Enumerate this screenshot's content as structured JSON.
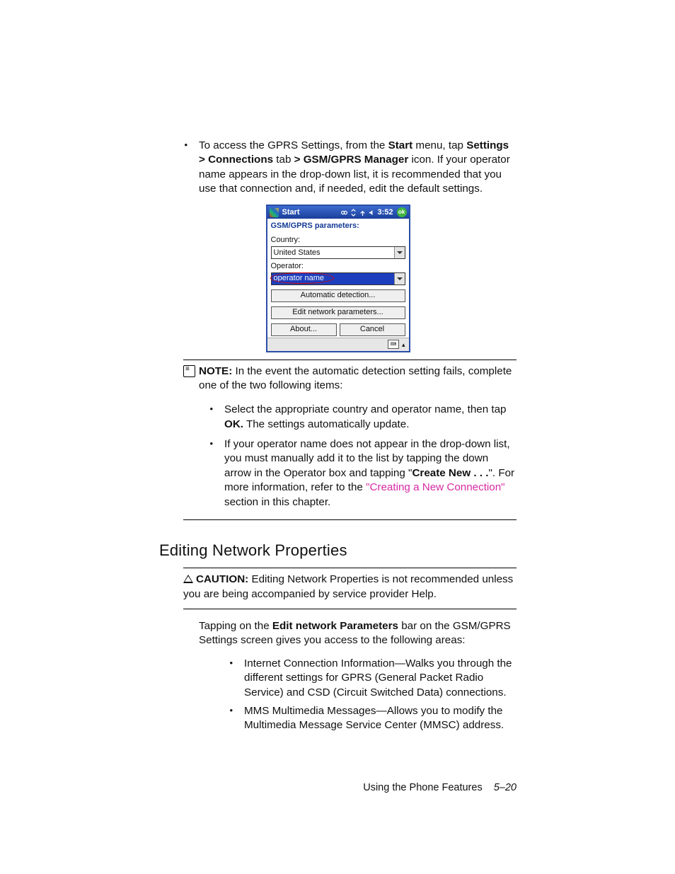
{
  "intro": {
    "prefix": "To access the GPRS Settings, from the ",
    "start": "Start",
    "mid1": " menu, tap ",
    "settings_path": "Settings > Connections",
    "mid2": " tab ",
    "gsm_path": "> GSM/GPRS Manager",
    "tail": " icon. If your operator name appears in the drop-down list, it is recommended that you use that connection and, if needed, edit the default settings."
  },
  "screenshot": {
    "start": "Start",
    "time": "3:52",
    "ok": "ok",
    "heading": "GSM/GPRS parameters:",
    "country_label": "Country:",
    "country_value": "United States",
    "operator_label": "Operator:",
    "operator_value": "operator name",
    "btn_auto": "Automatic detection...",
    "btn_edit": "Edit network parameters...",
    "btn_about": "About...",
    "btn_cancel": "Cancel"
  },
  "note": {
    "label": "NOTE:",
    "text": "In the event the automatic detection setting fails, complete one of the two following items:"
  },
  "note_bullets": [
    {
      "pre": "Select the appropriate country and operator name, then tap ",
      "bold": "OK.",
      "post": " The settings automatically update."
    },
    {
      "pre": "If your operator name does not appear in the drop-down list, you must manually add it to the list by tapping the down arrow in the Operator box and tapping \"",
      "bold": "Create New . . .",
      "post1": "\". For more information, refer to the ",
      "link": "\"Creating a New Connection\"",
      "post2": " section in this chapter."
    }
  ],
  "h2": "Editing Network Properties",
  "caution": {
    "label": "CAUTION:",
    "text": "Editing Network Properties is not recommended unless you are being accompanied by service provider Help."
  },
  "para": {
    "pre": "Tapping on the ",
    "bold": "Edit network Parameters",
    "post": " bar on the GSM/GPRS Settings screen gives you access to the following areas:"
  },
  "areas": [
    "Internet Connection Information—Walks you through the different settings for GPRS (General Packet Radio Service) and CSD (Circuit Switched Data) connections.",
    "MMS Multimedia Messages—Allows you to modify the Multimedia Message Service Center (MMSC) address."
  ],
  "footer": {
    "section": "Using the Phone Features",
    "page": "5–20"
  }
}
